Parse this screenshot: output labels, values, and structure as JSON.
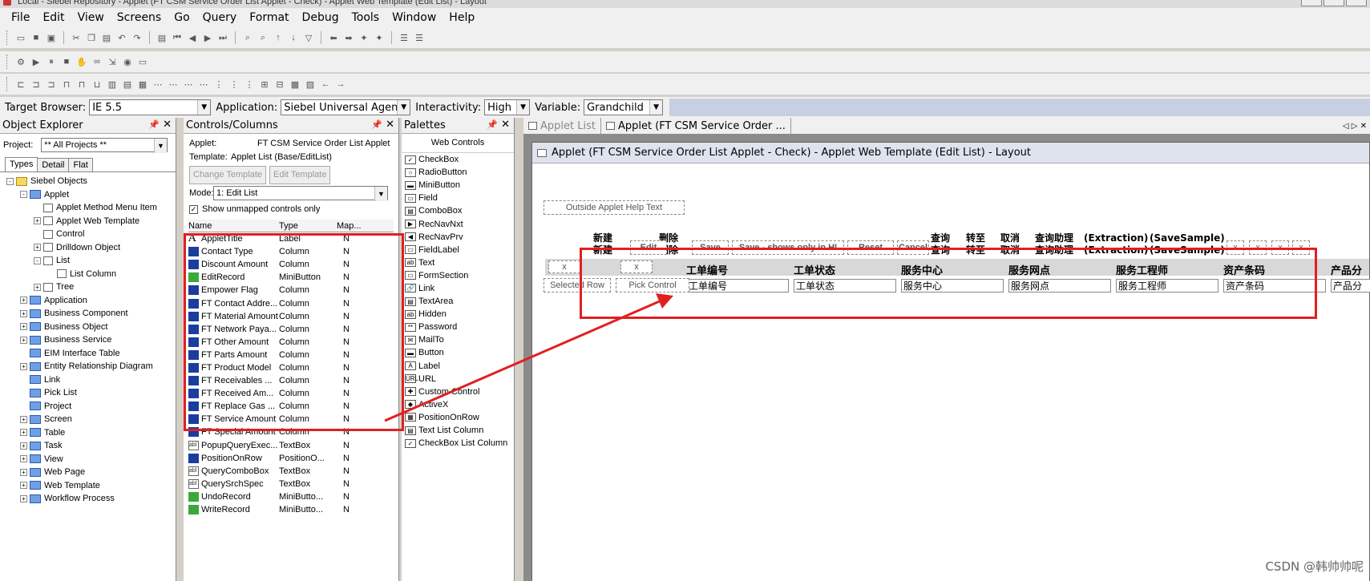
{
  "window": {
    "title": "Local - Siebel Repository - Applet (FT CSM Service Order List Applet - Check) - Applet Web Template (Edit List) - Layout"
  },
  "menu": [
    "File",
    "Edit",
    "View",
    "Screens",
    "Go",
    "Query",
    "Format",
    "Debug",
    "Tools",
    "Window",
    "Help"
  ],
  "propbar": {
    "target_browser_label": "Target Browser:",
    "target_browser_value": "IE 5.5",
    "application_label": "Application:",
    "application_value": "Siebel Universal Agent",
    "interactivity_label": "Interactivity:",
    "interactivity_value": "High",
    "variable_label": "Variable:",
    "variable_value": "Grandchild"
  },
  "explorer": {
    "title": "Object Explorer",
    "project_label": "Project:",
    "project_value": "** All Projects **",
    "tabs": [
      "Types",
      "Detail",
      "Flat"
    ],
    "tree": [
      {
        "label": "Siebel Objects",
        "level": 0,
        "expander": "-",
        "icon": "folder"
      },
      {
        "label": "Applet",
        "level": 1,
        "expander": "-",
        "icon": "color"
      },
      {
        "label": "Applet Method Menu Item",
        "level": 2,
        "expander": "",
        "icon": "doc"
      },
      {
        "label": "Applet Web Template",
        "level": 2,
        "expander": "+",
        "icon": "doc"
      },
      {
        "label": "Control",
        "level": 2,
        "expander": "",
        "icon": "doc"
      },
      {
        "label": "Drilldown Object",
        "level": 2,
        "expander": "+",
        "icon": "doc"
      },
      {
        "label": "List",
        "level": 2,
        "expander": "-",
        "icon": "doc"
      },
      {
        "label": "List Column",
        "level": 3,
        "expander": "",
        "icon": "doc"
      },
      {
        "label": "Tree",
        "level": 2,
        "expander": "+",
        "icon": "doc"
      },
      {
        "label": "Application",
        "level": 1,
        "expander": "+",
        "icon": "color"
      },
      {
        "label": "Business Component",
        "level": 1,
        "expander": "+",
        "icon": "color"
      },
      {
        "label": "Business Object",
        "level": 1,
        "expander": "+",
        "icon": "color"
      },
      {
        "label": "Business Service",
        "level": 1,
        "expander": "+",
        "icon": "color"
      },
      {
        "label": "EIM Interface Table",
        "level": 1,
        "expander": "",
        "icon": "color"
      },
      {
        "label": "Entity Relationship Diagram",
        "level": 1,
        "expander": "+",
        "icon": "color"
      },
      {
        "label": "Link",
        "level": 1,
        "expander": "",
        "icon": "color"
      },
      {
        "label": "Pick List",
        "level": 1,
        "expander": "",
        "icon": "color"
      },
      {
        "label": "Project",
        "level": 1,
        "expander": "",
        "icon": "color"
      },
      {
        "label": "Screen",
        "level": 1,
        "expander": "+",
        "icon": "color"
      },
      {
        "label": "Table",
        "level": 1,
        "expander": "+",
        "icon": "color"
      },
      {
        "label": "Task",
        "level": 1,
        "expander": "+",
        "icon": "color"
      },
      {
        "label": "View",
        "level": 1,
        "expander": "+",
        "icon": "color"
      },
      {
        "label": "Web Page",
        "level": 1,
        "expander": "+",
        "icon": "color"
      },
      {
        "label": "Web Template",
        "level": 1,
        "expander": "+",
        "icon": "color"
      },
      {
        "label": "Workflow Process",
        "level": 1,
        "expander": "+",
        "icon": "color"
      }
    ]
  },
  "controls": {
    "title": "Controls/Columns",
    "applet_label": "Applet:",
    "applet_value": "FT CSM Service Order List Applet",
    "template_label": "Template:",
    "template_value": "Applet List (Base/EditList)",
    "change_template": "Change Template",
    "edit_template": "Edit Template",
    "mode_label": "Mode:",
    "mode_value": "1: Edit List",
    "show_unmapped": "Show unmapped controls only",
    "columns": [
      "Name",
      "Type",
      "Map..."
    ],
    "rows": [
      {
        "name": "AppletTitle",
        "type": "Label",
        "map": "N",
        "icon": "label"
      },
      {
        "name": "Contact Type",
        "type": "Column",
        "map": "N",
        "icon": "col"
      },
      {
        "name": "Discount Amount",
        "type": "Column",
        "map": "N",
        "icon": "col"
      },
      {
        "name": "EditRecord",
        "type": "MiniButton",
        "map": "N",
        "icon": "mini"
      },
      {
        "name": "Empower Flag",
        "type": "Column",
        "map": "N",
        "icon": "col"
      },
      {
        "name": "FT Contact Addre...",
        "type": "Column",
        "map": "N",
        "icon": "col"
      },
      {
        "name": "FT Material Amount",
        "type": "Column",
        "map": "N",
        "icon": "col"
      },
      {
        "name": "FT Network Paya...",
        "type": "Column",
        "map": "N",
        "icon": "col"
      },
      {
        "name": "FT Other Amount",
        "type": "Column",
        "map": "N",
        "icon": "col"
      },
      {
        "name": "FT Parts Amount",
        "type": "Column",
        "map": "N",
        "icon": "col"
      },
      {
        "name": "FT Product Model",
        "type": "Column",
        "map": "N",
        "icon": "col"
      },
      {
        "name": "FT Receivables ...",
        "type": "Column",
        "map": "N",
        "icon": "col"
      },
      {
        "name": "FT Received Am...",
        "type": "Column",
        "map": "N",
        "icon": "col"
      },
      {
        "name": "FT Replace Gas ...",
        "type": "Column",
        "map": "N",
        "icon": "col"
      },
      {
        "name": "FT Service Amount",
        "type": "Column",
        "map": "N",
        "icon": "col"
      },
      {
        "name": "FT Special Amount",
        "type": "Column",
        "map": "N",
        "icon": "col"
      },
      {
        "name": "PopupQueryExec...",
        "type": "TextBox",
        "map": "N",
        "icon": "text"
      },
      {
        "name": "PositionOnRow",
        "type": "PositionO...",
        "map": "N",
        "icon": "col"
      },
      {
        "name": "QueryComboBox",
        "type": "TextBox",
        "map": "N",
        "icon": "text"
      },
      {
        "name": "QuerySrchSpec",
        "type": "TextBox",
        "map": "N",
        "icon": "text"
      },
      {
        "name": "UndoRecord",
        "type": "MiniButto...",
        "map": "N",
        "icon": "mini"
      },
      {
        "name": "WriteRecord",
        "type": "MiniButto...",
        "map": "N",
        "icon": "mini"
      }
    ]
  },
  "palettes": {
    "title": "Palettes",
    "section": "Web Controls",
    "items": [
      "CheckBox",
      "RadioButton",
      "MiniButton",
      "Field",
      "ComboBox",
      "RecNavNxt",
      "RecNavPrv",
      "FieldLabel",
      "Text",
      "FormSection",
      "Link",
      "TextArea",
      "Hidden",
      "Password",
      "MailTo",
      "Button",
      "Label",
      "URL",
      "Custom Control",
      "ActiveX",
      "PositionOnRow",
      "Text List Column",
      "CheckBox List Column"
    ]
  },
  "editor": {
    "tabs": [
      "Applet List",
      "Applet (FT CSM Service Order ..."
    ],
    "title": "Applet (FT CSM Service Order List Applet - Check) - Applet Web Template (Edit List) - Layout",
    "help_text": "Outside Applet Help Text",
    "buttons_single": [
      "Edit",
      "Save",
      "Save - shows only in HI",
      "Reset",
      "Cancel"
    ],
    "buttons_double": [
      "新建",
      "删除",
      "查询",
      "转至",
      "取消",
      "查询助理",
      "(Extraction)",
      "(SaveSample)"
    ],
    "small_x": [
      "x",
      "x",
      "x",
      "x"
    ],
    "selected_row": "Selected Row",
    "pick_control": "Pick Control",
    "header_x": "x",
    "list_columns": [
      "工单编号",
      "工单状态",
      "服务中心",
      "服务网点",
      "服务工程师",
      "资产条码",
      "产品分"
    ]
  },
  "watermark": "CSDN @韩帅帅呢"
}
